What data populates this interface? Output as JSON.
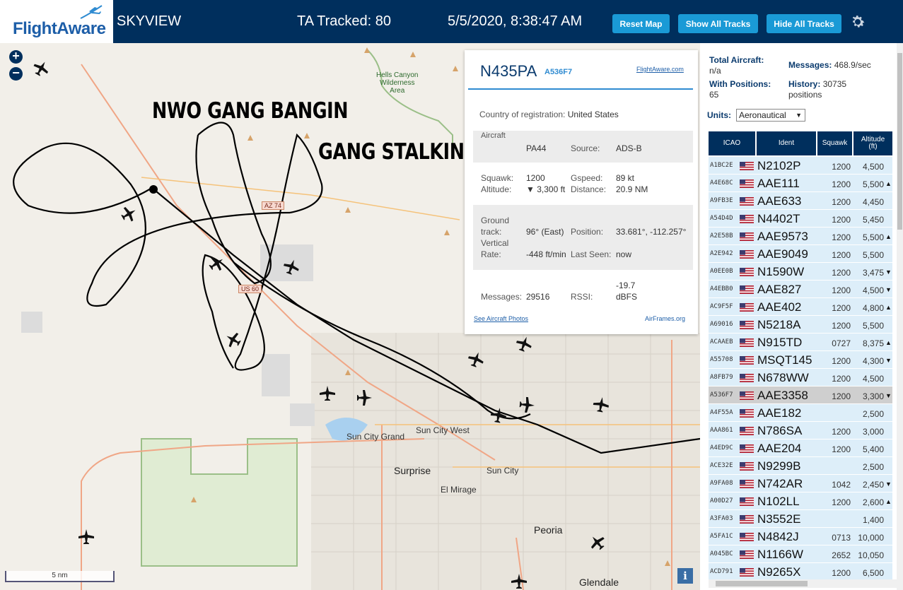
{
  "header": {
    "logo_text": "FlightAware",
    "app_title": "SKYVIEW",
    "tracked": "TA Tracked: 80",
    "datetime": "5/5/2020, 8:38:47 AM",
    "reset_map": "Reset Map",
    "show_all": "Show All Tracks",
    "hide_all": "Hide All Tracks"
  },
  "map": {
    "overlay_line1": "NWO GANG BANGIN",
    "overlay_line2": "GANG STALKING",
    "wilderness": "Hells Canyon\nWilderness\nArea",
    "places": {
      "sun_city_west": "Sun City West",
      "sun_city_grand": "Sun City Grand",
      "surprise": "Surprise",
      "sun_city": "Sun City",
      "el_mirage": "El Mirage",
      "peoria": "Peoria",
      "glendale": "Glendale"
    },
    "roads": {
      "az74": "AZ 74",
      "us60": "US 60"
    },
    "scale": "5 nm",
    "info": "i"
  },
  "popup": {
    "ident": "N435PA",
    "hex": "A536F7",
    "fa_link": "FlightAware.com",
    "country_label": "Country of registration:",
    "country": "United States",
    "aircraft_label": "Aircraft",
    "aircraft": "PA44",
    "source_label": "Source:",
    "source": "ADS-B",
    "squawk_label": "Squawk:",
    "squawk": "1200",
    "gspeed_label": "Gspeed:",
    "gspeed": "89 kt",
    "altitude_label": "Altitude:",
    "altitude": "▼ 3,300 ft",
    "distance_label": "Distance:",
    "distance": "20.9 NM",
    "ground_label": "Ground",
    "track_label": "track:",
    "track": "96° (East)",
    "position_label": "Position:",
    "position": "33.681°, -112.257°",
    "vertical_label": "Vertical",
    "rate_label": "Rate:",
    "rate": "-448 ft/min",
    "last_seen_label": "Last Seen:",
    "last_seen": "now",
    "messages_label": "Messages:",
    "messages": "29516",
    "rssi_label": "RSSI:",
    "rssi_value": "-19.7",
    "rssi_unit": "dBFS",
    "photos": "See Aircraft Photos",
    "airframes": "AirFrames.org"
  },
  "sidebar": {
    "total_label": "Total Aircraft:",
    "total": "n/a",
    "messages_label": "Messages:",
    "messages": "468.9/sec",
    "with_pos_label": "With Positions:",
    "with_pos": "65",
    "history_label": "History:",
    "history_value": "30735",
    "history_unit": "positions",
    "units_label": "Units:",
    "units_value": "Aeronautical",
    "columns": {
      "icao": "ICAO",
      "ident": "Ident",
      "squawk": "Squawk",
      "alt1": "Altitude",
      "alt2": "(ft)"
    },
    "rows": [
      {
        "icao": "A1BC2E",
        "ident": "N2102P",
        "squawk": "1200",
        "alt": "4,500",
        "arrow": ""
      },
      {
        "icao": "A4E68C",
        "ident": "AAE111",
        "squawk": "1200",
        "alt": "5,500",
        "arrow": "▲"
      },
      {
        "icao": "A9FB3E",
        "ident": "AAE633",
        "squawk": "1200",
        "alt": "4,450",
        "arrow": ""
      },
      {
        "icao": "A54D4D",
        "ident": "N4402T",
        "squawk": "1200",
        "alt": "5,450",
        "arrow": ""
      },
      {
        "icao": "A2E58B",
        "ident": "AAE9573",
        "squawk": "1200",
        "alt": "5,500",
        "arrow": "▲"
      },
      {
        "icao": "A2E942",
        "ident": "AAE9049",
        "squawk": "1200",
        "alt": "5,500",
        "arrow": ""
      },
      {
        "icao": "A0EE0B",
        "ident": "N1590W",
        "squawk": "1200",
        "alt": "3,475",
        "arrow": "▼"
      },
      {
        "icao": "A4EBB0",
        "ident": "AAE827",
        "squawk": "1200",
        "alt": "4,500",
        "arrow": "▼"
      },
      {
        "icao": "AC9F5F",
        "ident": "AAE402",
        "squawk": "1200",
        "alt": "4,800",
        "arrow": "▲"
      },
      {
        "icao": "A69016",
        "ident": "N5218A",
        "squawk": "1200",
        "alt": "5,500",
        "arrow": ""
      },
      {
        "icao": "ACAAEB",
        "ident": "N915TD",
        "squawk": "0727",
        "alt": "8,375",
        "arrow": "▲"
      },
      {
        "icao": "A55708",
        "ident": "MSQT145",
        "squawk": "1200",
        "alt": "4,300",
        "arrow": "▼"
      },
      {
        "icao": "A8FB79",
        "ident": "N678WW",
        "squawk": "1200",
        "alt": "4,500",
        "arrow": ""
      },
      {
        "icao": "A536F7",
        "ident": "AAE3358",
        "squawk": "1200",
        "alt": "3,300",
        "arrow": "▼"
      },
      {
        "icao": "A4F55A",
        "ident": "AAE182",
        "squawk": "",
        "alt": "2,500",
        "arrow": ""
      },
      {
        "icao": "AAA861",
        "ident": "N786SA",
        "squawk": "1200",
        "alt": "3,000",
        "arrow": ""
      },
      {
        "icao": "A4ED9C",
        "ident": "AAE204",
        "squawk": "1200",
        "alt": "5,400",
        "arrow": ""
      },
      {
        "icao": "ACE32E",
        "ident": "N9299B",
        "squawk": "",
        "alt": "2,500",
        "arrow": ""
      },
      {
        "icao": "A9FA08",
        "ident": "N742AR",
        "squawk": "1042",
        "alt": "2,450",
        "arrow": "▼"
      },
      {
        "icao": "A00D27",
        "ident": "N102LL",
        "squawk": "1200",
        "alt": "2,600",
        "arrow": "▲"
      },
      {
        "icao": "A3FA03",
        "ident": "N3552E",
        "squawk": "",
        "alt": "1,400",
        "arrow": ""
      },
      {
        "icao": "A5FA1C",
        "ident": "N4842J",
        "squawk": "0713",
        "alt": "10,000",
        "arrow": ""
      },
      {
        "icao": "A045BC",
        "ident": "N1166W",
        "squawk": "2652",
        "alt": "10,050",
        "arrow": ""
      },
      {
        "icao": "ACD791",
        "ident": "N9265X",
        "squawk": "1200",
        "alt": "6,500",
        "arrow": ""
      }
    ],
    "selected_icao": "A536F7"
  }
}
